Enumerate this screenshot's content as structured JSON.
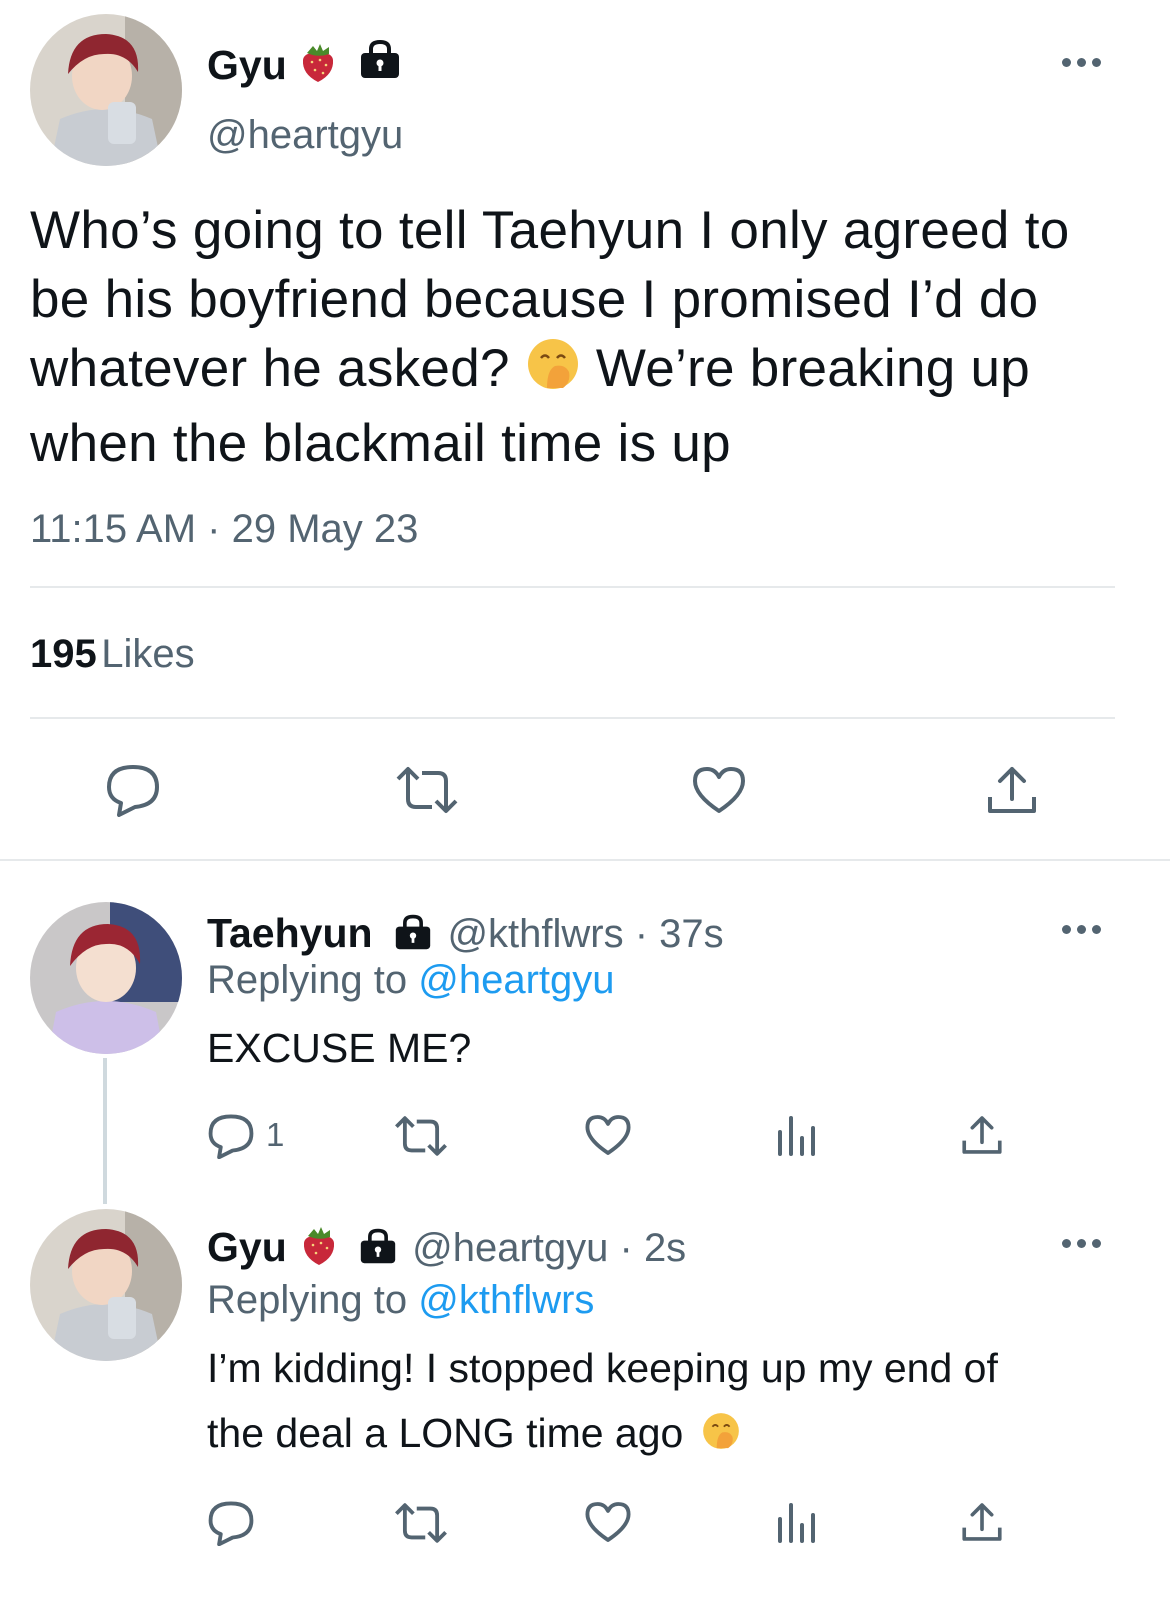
{
  "main_tweet": {
    "name": "Gyu",
    "handle": "@heartgyu",
    "text_part1": "Who’s going to tell Taehyun I only agreed to be his boyfriend because I promised I’d do whatever he asked?",
    "text_part2": "We’re breaking up when the blackmail time is up",
    "emoji": "hand-over-mouth-emoji",
    "time": "11:15 AM",
    "date": "29 May 23",
    "likes_count": "195",
    "likes_label": "Likes",
    "badges": [
      "strawberry-icon",
      "lock-icon"
    ]
  },
  "replies": [
    {
      "name": "Taehyun",
      "handle": "@kthflwrs",
      "age": "37s",
      "replying_label": "Replying to",
      "replying_handle": "@heartgyu",
      "text": "EXCUSE ME?",
      "reply_count": "1"
    },
    {
      "name": "Gyu",
      "handle": "@heartgyu",
      "age": "2s",
      "replying_label": "Replying to",
      "replying_handle": "@kthflwrs",
      "text_line1": "I’m kidding! I stopped keeping up my end of",
      "text_line2": "the deal a LONG time ago",
      "emoji": "hand-over-mouth-emoji"
    }
  ],
  "colors": {
    "text": "#0f1419",
    "secondary": "#536471",
    "link": "#1d9bf0",
    "divider": "#e6e9eb",
    "strawberry": "#c8283a"
  }
}
